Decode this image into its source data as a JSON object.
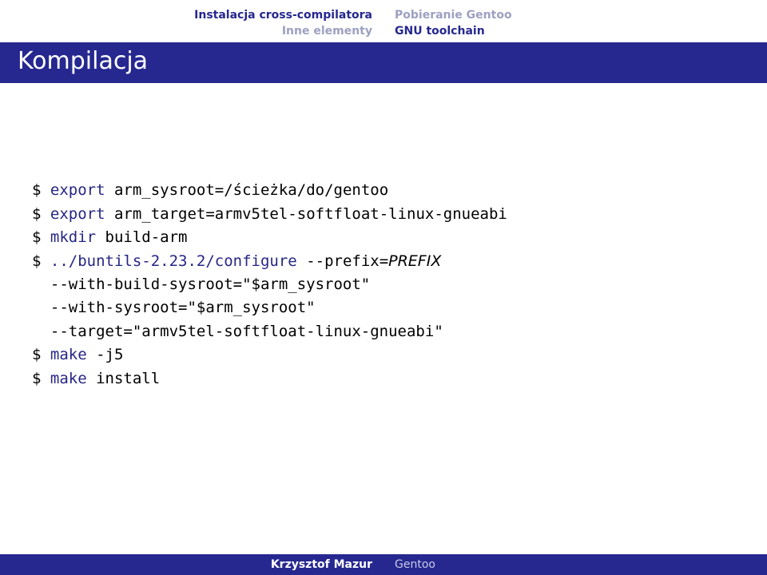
{
  "nav": {
    "left": [
      {
        "text": "Instalacja cross-compilatora",
        "cls": "nav-active"
      },
      {
        "text": "Inne elementy",
        "cls": "nav-dim"
      }
    ],
    "right": [
      {
        "text": "Pobieranie Gentoo",
        "cls": "nav-dim"
      },
      {
        "text": "GNU toolchain",
        "cls": "nav-active"
      }
    ]
  },
  "title": "Kompilacja",
  "code": [
    [
      {
        "t": "$ ",
        "c": ""
      },
      {
        "t": "export",
        "c": "cmd"
      },
      {
        "t": " arm_sysroot=/ścieżka/do/gentoo",
        "c": ""
      }
    ],
    [
      {
        "t": "$ ",
        "c": ""
      },
      {
        "t": "export",
        "c": "cmd"
      },
      {
        "t": " arm_target=armv5tel-softfloat-linux-gnueabi",
        "c": ""
      }
    ],
    [
      {
        "t": "$ ",
        "c": ""
      },
      {
        "t": "mkdir",
        "c": "cmd"
      },
      {
        "t": " build-arm",
        "c": ""
      }
    ],
    [
      {
        "t": "$ ",
        "c": ""
      },
      {
        "t": "../buntils-2.23.2/configure",
        "c": "cmd"
      },
      {
        "t": " --prefix=",
        "c": ""
      },
      {
        "t": "PREFIX",
        "c": "arg"
      }
    ],
    [
      {
        "t": "  --with-build-sysroot=\"$arm_sysroot\"",
        "c": ""
      }
    ],
    [
      {
        "t": "  --with-sysroot=\"$arm_sysroot\"",
        "c": ""
      }
    ],
    [
      {
        "t": "  --target=\"armv5tel-softfloat-linux-gnueabi\"",
        "c": ""
      }
    ],
    [
      {
        "t": "$ ",
        "c": ""
      },
      {
        "t": "make",
        "c": "cmd"
      },
      {
        "t": " -j5",
        "c": ""
      }
    ],
    [
      {
        "t": "$ ",
        "c": ""
      },
      {
        "t": "make",
        "c": "cmd"
      },
      {
        "t": " install",
        "c": ""
      }
    ]
  ],
  "footer": {
    "left": "Krzysztof Mazur",
    "right": "Gentoo"
  }
}
